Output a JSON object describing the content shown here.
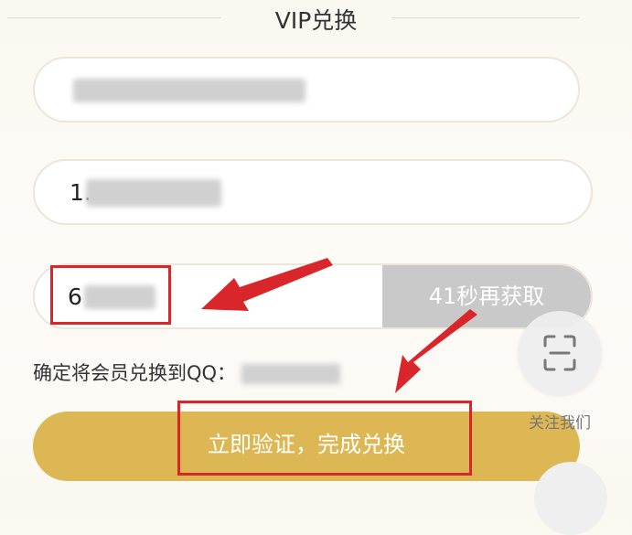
{
  "header": {
    "title": "VIP兑换"
  },
  "form": {
    "account_field": {
      "value": ""
    },
    "phone_field": {
      "value_visible": "1."
    },
    "code_field": {
      "value_visible": "6"
    },
    "countdown_button": {
      "label": "41秒再获取"
    },
    "confirm_text": "确定将会员兑换到QQ：",
    "submit_button": {
      "label": "立即验证，完成兑换"
    }
  },
  "floating": {
    "scan_icon": "scan-icon",
    "follow_label": "关注我们"
  },
  "annotations": {
    "highlight_color": "#d9262b"
  }
}
